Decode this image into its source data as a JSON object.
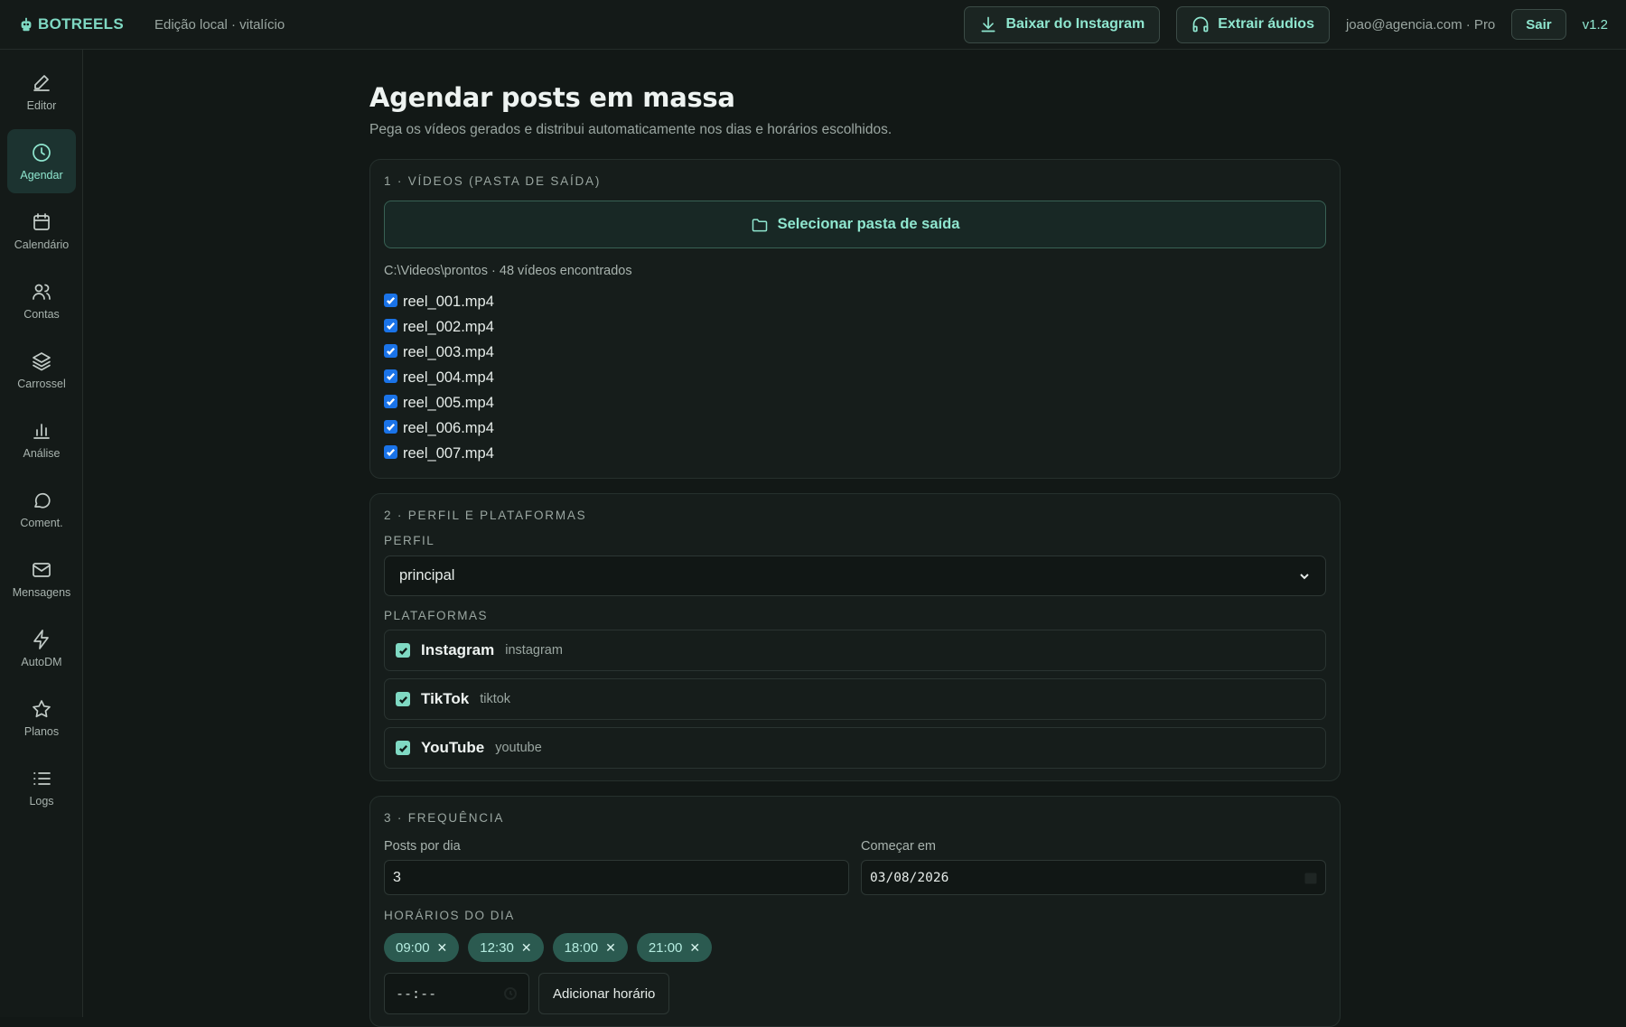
{
  "app": {
    "name": "BOTREELS",
    "edition": "Edição local · vitalício",
    "user": "joao@agencia.com · Pro",
    "version": "v1.2"
  },
  "topbar": {
    "download_instagram": "Baixar do Instagram",
    "extract_audio": "Extrair áudios",
    "logout": "Sair"
  },
  "sidebar": {
    "items": [
      {
        "label": "Editor",
        "icon": "pencil-icon",
        "active": false
      },
      {
        "label": "Agendar",
        "icon": "clock-icon",
        "active": true
      },
      {
        "label": "Calendário",
        "icon": "calendar-icon",
        "active": false
      },
      {
        "label": "Contas",
        "icon": "users-icon",
        "active": false
      },
      {
        "label": "Carrossel",
        "icon": "layers-icon",
        "active": false
      },
      {
        "label": "Análise",
        "icon": "bar-chart-icon",
        "active": false
      },
      {
        "label": "Coment.",
        "icon": "comment-icon",
        "active": false
      },
      {
        "label": "Mensagens",
        "icon": "mail-icon",
        "active": false
      },
      {
        "label": "AutoDM",
        "icon": "zap-icon",
        "active": false
      },
      {
        "label": "Planos",
        "icon": "star-icon",
        "active": false
      },
      {
        "label": "Logs",
        "icon": "list-icon",
        "active": false
      }
    ]
  },
  "page": {
    "title": "Agendar posts em massa",
    "subtitle": "Pega os vídeos gerados e distribui automaticamente nos dias e horários escolhidos."
  },
  "videos": {
    "section_title": "1 · VÍDEOS (PASTA DE SAÍDA)",
    "select_folder": "Selecionar pasta de saída",
    "folder_info": "C:\\Videos\\prontos · 48 vídeos encontrados",
    "files": [
      "reel_001.mp4",
      "reel_002.mp4",
      "reel_003.mp4",
      "reel_004.mp4",
      "reel_005.mp4",
      "reel_006.mp4",
      "reel_007.mp4"
    ]
  },
  "profile": {
    "section_title": "2 · PERFIL E PLATAFORMAS",
    "profile_label": "PERFIL",
    "profile_value": "principal",
    "platforms_label": "PLATAFORMAS",
    "platforms": [
      {
        "name": "Instagram",
        "key": "instagram",
        "checked": true
      },
      {
        "name": "TikTok",
        "key": "tiktok",
        "checked": true
      },
      {
        "name": "YouTube",
        "key": "youtube",
        "checked": true
      }
    ]
  },
  "frequency": {
    "section_title": "3 · FREQUÊNCIA",
    "posts_per_day_label": "Posts por dia",
    "posts_per_day_value": "3",
    "start_label": "Começar em",
    "start_value": "03/08/2026",
    "times_label": "HORÁRIOS DO DIA",
    "times": [
      "09:00",
      "12:30",
      "18:00",
      "21:00"
    ],
    "time_input_placeholder": "--:--",
    "add_time": "Adicionar horário"
  },
  "colors": {
    "accent": "#8fe6cf",
    "background": "#121816",
    "chip": "#2b5a50"
  }
}
